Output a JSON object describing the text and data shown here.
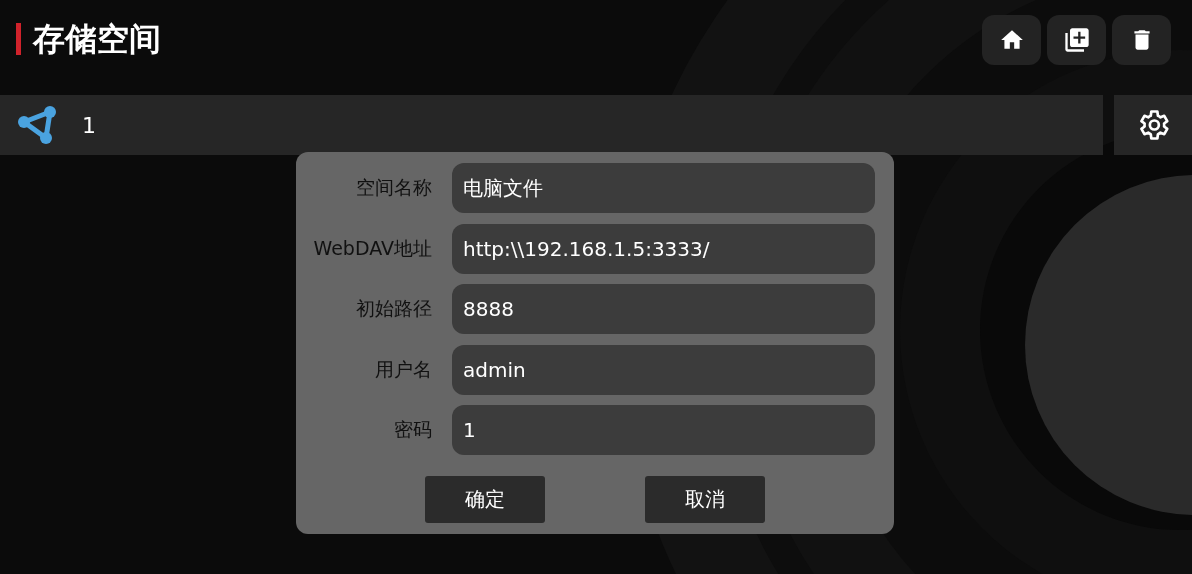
{
  "header": {
    "title": "存储空间"
  },
  "storage_list": [
    {
      "name": "1"
    }
  ],
  "dialog": {
    "fields": [
      {
        "label": "空间名称",
        "value": "电脑文件"
      },
      {
        "label": "WebDAV地址",
        "value": "http:\\\\192.168.1.5:3333/"
      },
      {
        "label": "初始路径",
        "value": "8888"
      },
      {
        "label": "用户名",
        "value": "admin"
      },
      {
        "label": "密码",
        "value": "1"
      }
    ],
    "buttons": [
      "确定",
      "取消"
    ]
  }
}
